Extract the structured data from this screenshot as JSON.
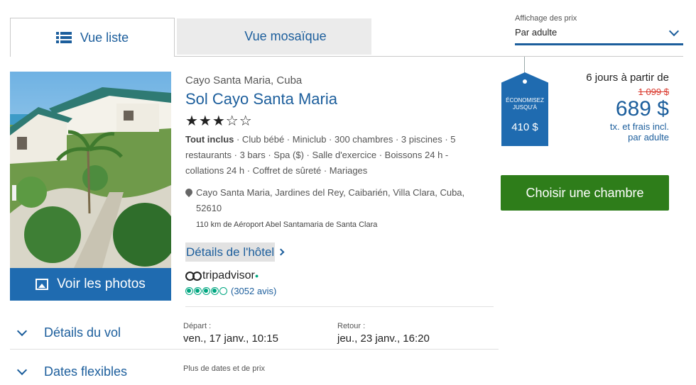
{
  "tabs": {
    "list_label": "Vue liste",
    "mosaic_label": "Vue mosaïque"
  },
  "price_display": {
    "label": "Affichage des prix",
    "value": "Par adulte"
  },
  "hotel": {
    "location": "Cayo Santa Maria, Cuba",
    "name": "Sol Cayo Santa Maria",
    "stars": "★★★☆☆",
    "star_rating": 3,
    "amenities_bold": "Tout inclus",
    "amenities_rest": " · Club bébé · Miniclub · 300 chambres · 3 piscines · 5 restaurants · 3 bars · Spa ($) · Salle d'exercice · Boissons 24 h - collations 24 h · Coffret de sûreté · Mariages",
    "address": "Cayo Santa Maria, Jardines del Rey, Caibarién, Villa Clara, Cuba, 52610",
    "airport": "110 km de Aéroport Abel Santamaria de Santa Clara",
    "details_link": "Détails de l'hôtel",
    "photos_button": "Voir les photos",
    "tripadvisor_brand": "tripadvisor",
    "tripadvisor_rating": 4,
    "tripadvisor_reviews": "(3052 avis)"
  },
  "pricing": {
    "tag_text": "Économisez jusqu'à",
    "tag_amount": "410 $",
    "from_text": "6 jours à partir de",
    "old_price": "1 099 $",
    "price": "689 $",
    "note_line1": "tx. et frais incl.",
    "note_line2": "par adulte",
    "choose_button": "Choisir une chambre"
  },
  "flight": {
    "toggle_label": "Détails du vol",
    "departure_label": "Départ :",
    "departure_value": "ven., 17 janv., 10:15",
    "return_label": "Retour :",
    "return_value": "jeu., 23 janv., 16:20"
  },
  "flex_dates": {
    "toggle_label": "Dates flexibles",
    "more_text": "Plus de dates et de prix"
  },
  "colors": {
    "brand_blue": "#1c5e9c",
    "button_blue": "#1f6bb0",
    "cta_green": "#2e7d1a",
    "old_price_red": "#d9372b",
    "tripadvisor_green": "#00a680"
  }
}
